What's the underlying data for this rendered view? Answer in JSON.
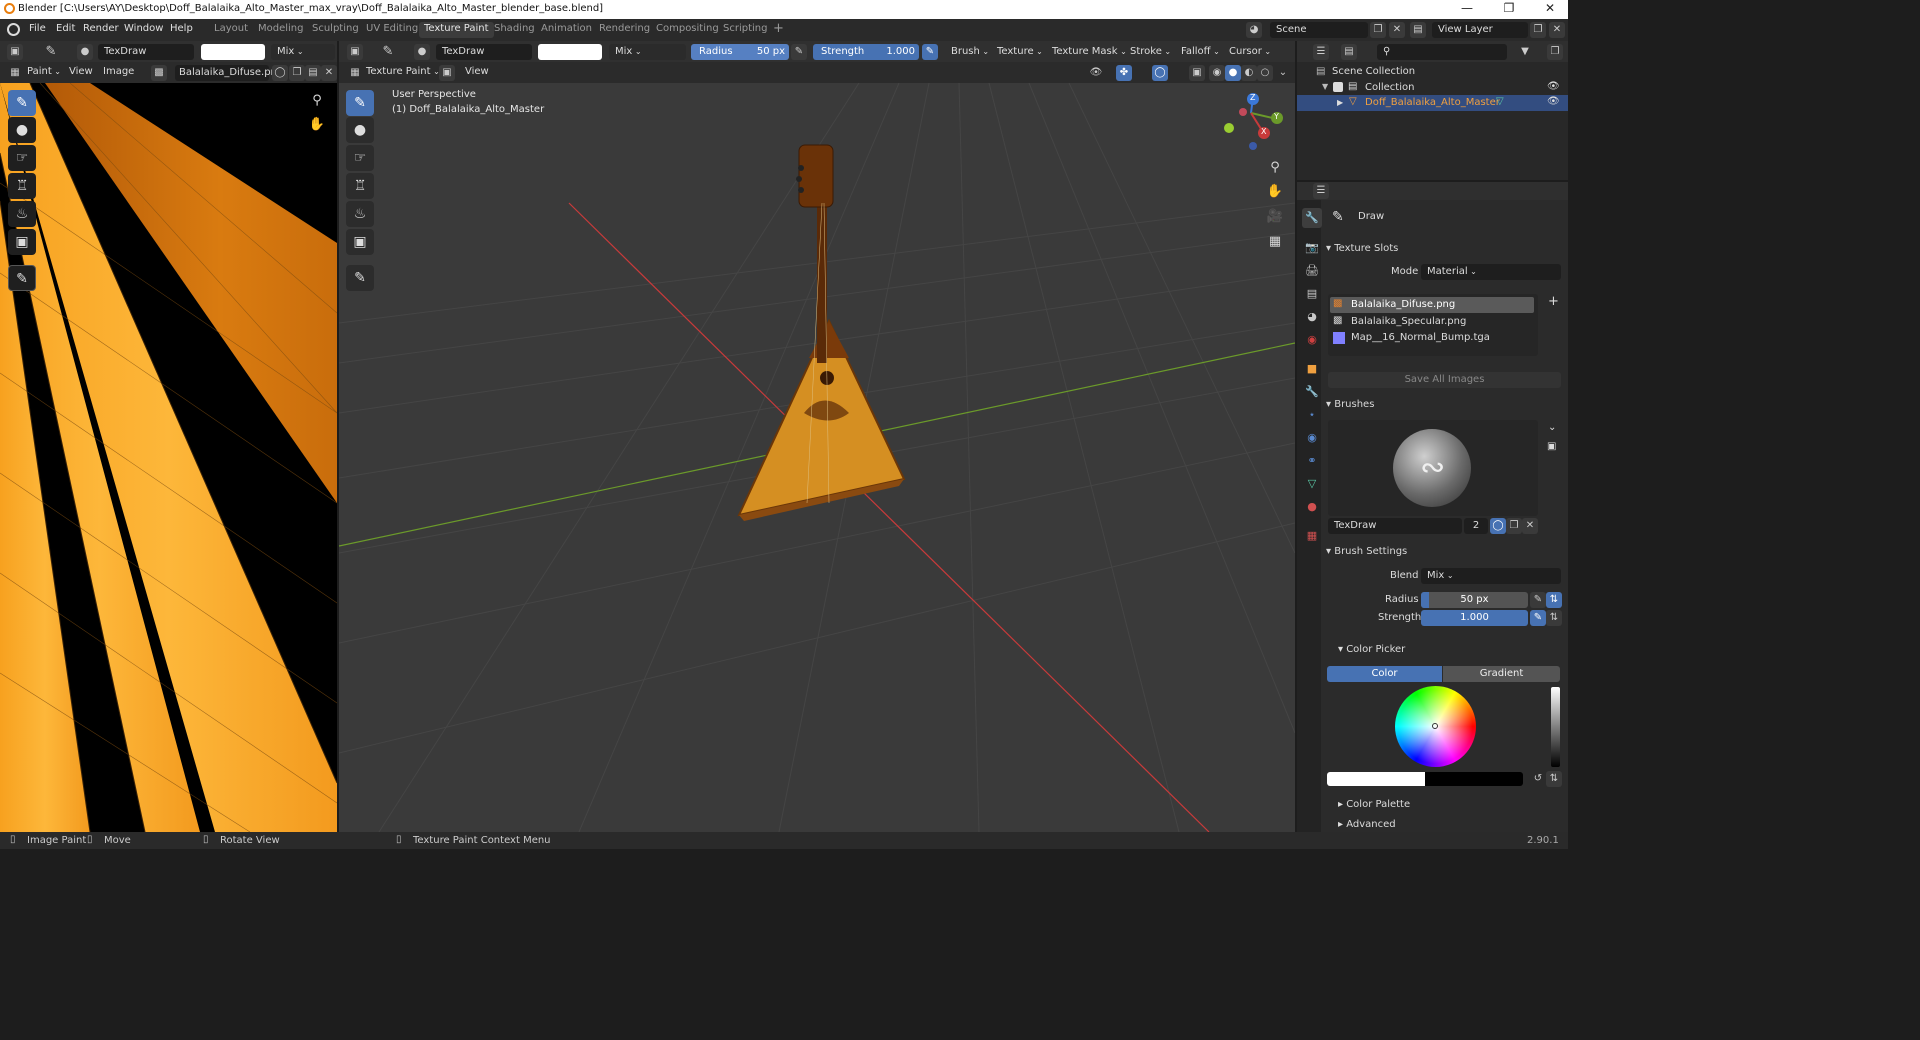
{
  "window": {
    "title": "Blender [C:\\Users\\AY\\Desktop\\Doff_Balalaika_Alto_Master_max_vray\\Doff_Balalaika_Alto_Master_blender_base.blend]",
    "minimize": "—",
    "maximize": "❐",
    "close": "✕"
  },
  "menu": [
    "File",
    "Edit",
    "Render",
    "Window",
    "Help"
  ],
  "workspaces": [
    "Layout",
    "Modeling",
    "Sculpting",
    "UV Editing",
    "Texture Paint",
    "Shading",
    "Animation",
    "Rendering",
    "Compositing",
    "Scripting"
  ],
  "active_workspace": "Texture Paint",
  "add_workspace": "+",
  "scene": {
    "label": "Scene"
  },
  "view_layer": {
    "label": "View Layer"
  },
  "image_editor": {
    "brush_name": "TexDraw",
    "blend": "Mix",
    "mode": "Paint",
    "view": "View",
    "image": "Image",
    "image_name": "Balalaika_Difuse.png"
  },
  "viewport": {
    "brush_name": "TexDraw",
    "blend": "Mix",
    "radius_label": "Radius",
    "radius_value": "50 px",
    "strength_label": "Strength",
    "strength_value": "1.000",
    "menus": [
      "Brush",
      "Texture",
      "Texture Mask",
      "Stroke",
      "Falloff",
      "Cursor"
    ],
    "mode": "Texture Paint",
    "view": "View",
    "perspective": "User Perspective",
    "object_line": "(1) Doff_Balalaika_Alto_Master",
    "gizmo": {
      "x": "X",
      "y": "Y",
      "z": "Z"
    }
  },
  "outliner": {
    "scene_collection": "Scene Collection",
    "collection": "Collection",
    "object": "Doff_Balalaika_Alto_Master"
  },
  "properties": {
    "tool": "Draw",
    "texture_slots": {
      "title": "Texture Slots",
      "mode_label": "Mode",
      "mode_value": "Material",
      "slots": [
        "Balalaika_Difuse.png",
        "Balalaika_Specular.png",
        "Map__16_Normal_Bump.tga"
      ],
      "save_all": "Save All Images"
    },
    "brushes": {
      "title": "Brushes",
      "name": "TexDraw",
      "users": "2"
    },
    "brush_settings": {
      "title": "Brush Settings",
      "blend_label": "Blend",
      "blend_value": "Mix",
      "radius_label": "Radius",
      "radius_value": "50 px",
      "strength_label": "Strength",
      "strength_value": "1.000"
    },
    "color_picker": {
      "title": "Color Picker",
      "tab_color": "Color",
      "tab_gradient": "Gradient"
    },
    "color_palette": "Color Palette",
    "advanced": "Advanced"
  },
  "status_bar": {
    "image_paint": "Image Paint",
    "move": "Move",
    "rotate_view": "Rotate View",
    "context_menu": "Texture Paint Context Menu",
    "version": "2.90.1"
  },
  "colors": {
    "accent": "#4772b3",
    "orange_wood": "#f39a1e",
    "x_axis": "#c83a3a",
    "y_axis": "#6b9a2a",
    "z_axis": "#3b78d8",
    "selected_row": "#334d80"
  }
}
